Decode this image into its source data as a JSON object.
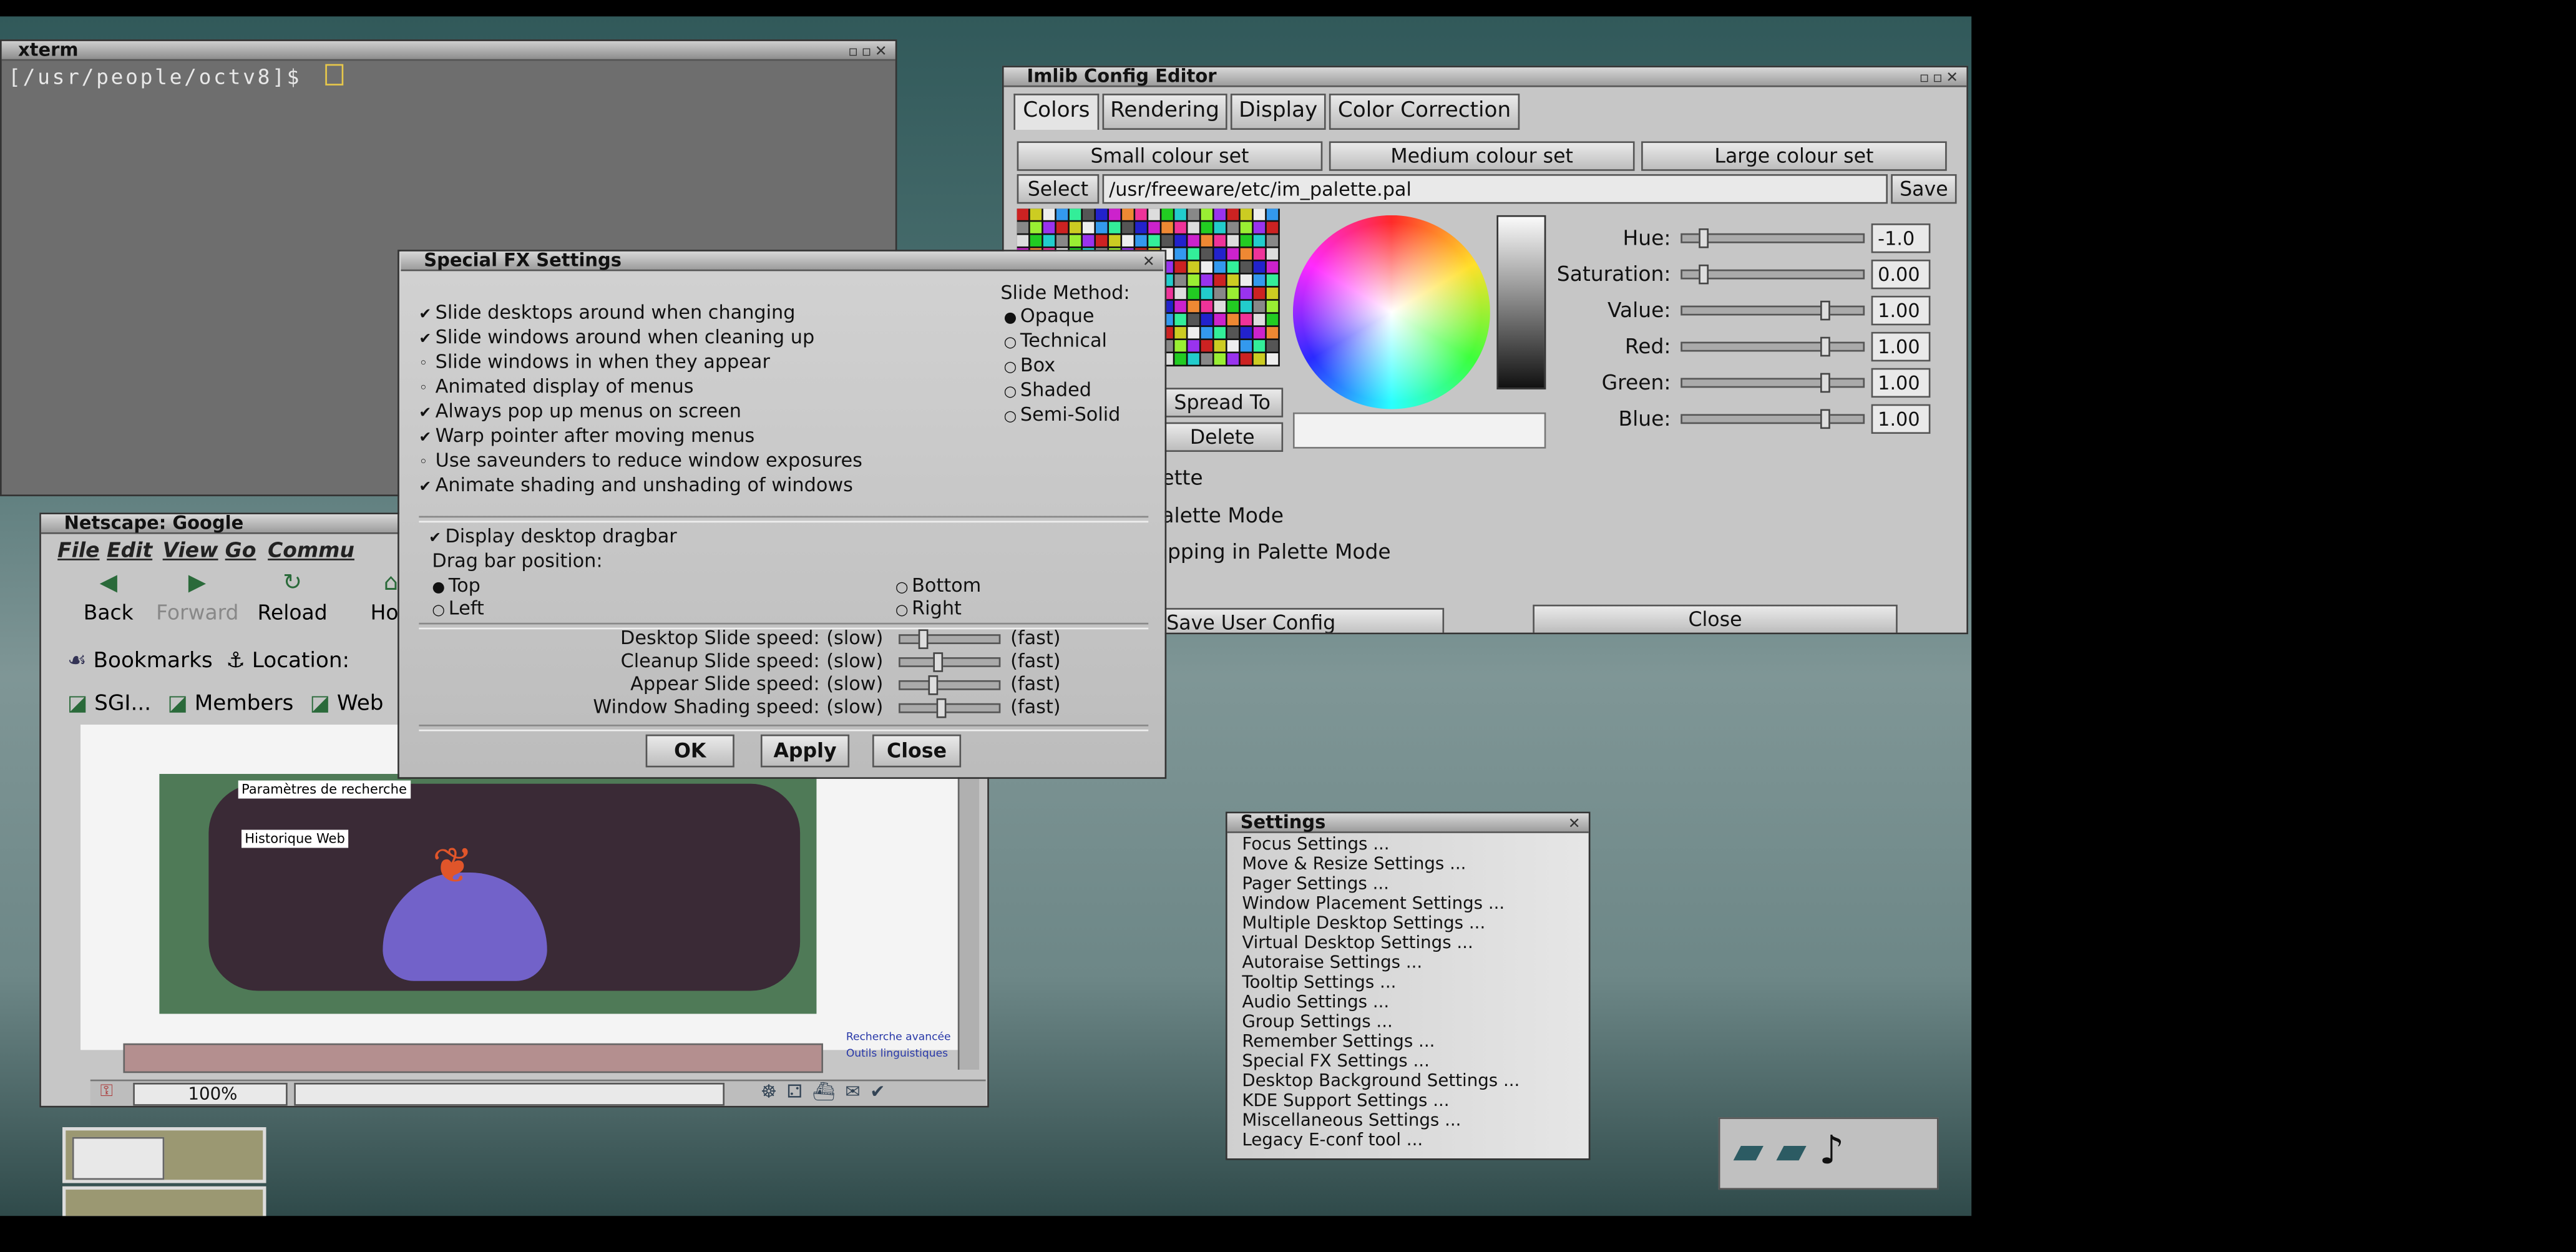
{
  "xterm": {
    "title": "xterm",
    "prompt": "[/usr/people/octv8]$"
  },
  "imlib": {
    "title": "Imlib Config Editor",
    "tabs": [
      "Colors",
      "Rendering",
      "Display",
      "Color Correction"
    ],
    "colour_sets": [
      "Small colour set",
      "Medium colour set",
      "Large colour set"
    ],
    "select_label": "Select",
    "path_value": "/usr/freeware/etc/im_palette.pal",
    "save_label": "Save",
    "adjust": [
      {
        "label": "Hue:",
        "value": "-1.0"
      },
      {
        "label": "Saturation:",
        "value": "0.00"
      },
      {
        "label": "Value:",
        "value": "1.00"
      },
      {
        "label": "Red:",
        "value": "1.00"
      },
      {
        "label": "Green:",
        "value": "1.00"
      },
      {
        "label": "Blue:",
        "value": "1.00"
      }
    ],
    "spread_label": "Spread To",
    "delete_label": "Delete",
    "frag_palette": "ette",
    "frag_palette_mode": "alette Mode",
    "frag_mapping": "apping in Palette Mode",
    "save_user_config": "Save User Config",
    "close_label": "Close"
  },
  "fx": {
    "title": "Special FX Settings",
    "options": [
      {
        "label": "Slide desktops around when changing",
        "checked": true
      },
      {
        "label": "Slide windows around when cleaning up",
        "checked": true
      },
      {
        "label": "Slide windows in when they appear",
        "checked": false
      },
      {
        "label": "Animated display of menus",
        "checked": false
      },
      {
        "label": "Always pop up menus on screen",
        "checked": true
      },
      {
        "label": "Warp pointer after moving menus",
        "checked": true
      },
      {
        "label": "Use saveunders to reduce window exposures",
        "checked": false
      },
      {
        "label": "Animate shading and unshading of windows",
        "checked": true
      }
    ],
    "slide_method_label": "Slide Method:",
    "methods": [
      {
        "label": "Opaque",
        "selected": true
      },
      {
        "label": "Technical",
        "selected": false
      },
      {
        "label": "Box",
        "selected": false
      },
      {
        "label": "Shaded",
        "selected": false
      },
      {
        "label": "Semi-Solid",
        "selected": false
      }
    ],
    "dragbar_option": "Display desktop dragbar",
    "dragbar_pos_label": "Drag bar position:",
    "positions": [
      {
        "label": "Top",
        "selected": true
      },
      {
        "label": "Bottom",
        "selected": false
      },
      {
        "label": "Left",
        "selected": false
      },
      {
        "label": "Right",
        "selected": false
      }
    ],
    "speeds": [
      {
        "label": "Desktop Slide speed:",
        "value": 0.2
      },
      {
        "label": "Cleanup Slide speed:",
        "value": 0.35
      },
      {
        "label": "Appear Slide speed:",
        "value": 0.3
      },
      {
        "label": "Window Shading speed:",
        "value": 0.4
      }
    ],
    "slow_label": "(slow)",
    "fast_label": "(fast)",
    "ok_label": "OK",
    "apply_label": "Apply",
    "close_label": "Close"
  },
  "netscape": {
    "title": "Netscape: Google",
    "menu": [
      "File",
      "Edit",
      "View",
      "Go",
      "Commu"
    ],
    "nav": [
      "Back",
      "Forward",
      "Reload",
      "Hon"
    ],
    "bookmarks_label": "Bookmarks",
    "location_label": "Location:",
    "personal": [
      "SGI...",
      "Members",
      "Web"
    ],
    "zoom": "100%",
    "page_snippets": [
      "Paramètres de recherche",
      "Historique Web",
      "Recherche avancée",
      "Outils linguistiques"
    ]
  },
  "settings_menu": {
    "title": "Settings",
    "items": [
      "Focus Settings ...",
      "Move & Resize Settings ...",
      "Pager Settings ...",
      "Window Placement Settings ...",
      "Multiple Desktop Settings ...",
      "Virtual Desktop Settings ...",
      "Autoraise Settings ...",
      "Tooltip Settings ...",
      "Audio Settings ...",
      "Group Settings ...",
      "Remember Settings ...",
      "Special FX Settings ...",
      "Desktop Background Settings ...",
      "KDE Support Settings ...",
      "Miscellaneous Settings ...",
      "Legacy E-conf tool ..."
    ]
  },
  "colors": {
    "desktop": "#5a7e7e",
    "window_gray": "#c6c6c6",
    "terminal_bg": "#6e6e6e",
    "prompt_text": "#e8e8e8"
  }
}
